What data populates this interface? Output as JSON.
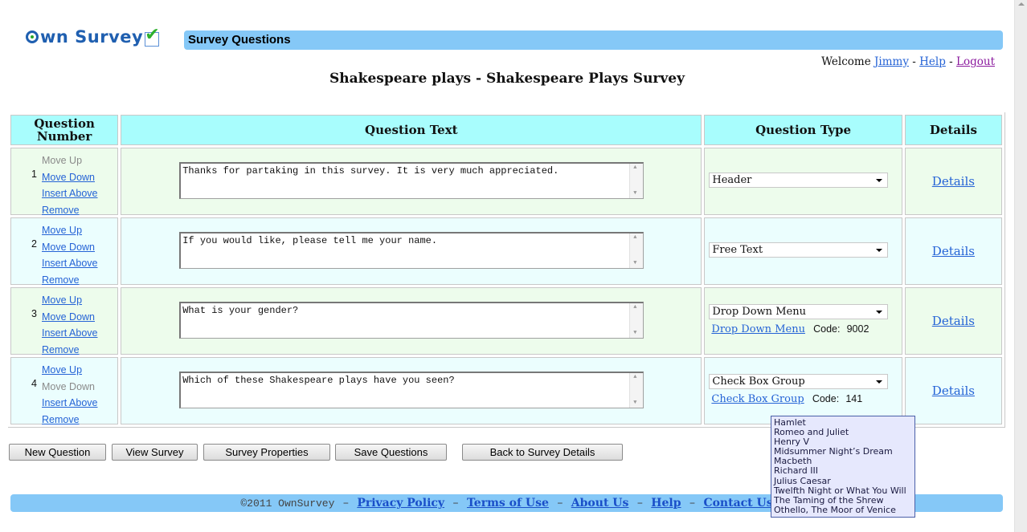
{
  "header": {
    "logo_text": "wn Survey",
    "page_heading": "Survey Questions",
    "welcome_prefix": "Welcome",
    "user_link": "Jimmy",
    "help_link": "Help",
    "logout_link": "Logout",
    "separator": "-",
    "survey_title": "Shakespeare plays - Shakespeare Plays Survey"
  },
  "table": {
    "columns": [
      "Question Number",
      "Question Text",
      "Question Type",
      "Details"
    ],
    "column_number_line1": "Question",
    "column_number_line2": "Number",
    "rows": [
      {
        "number": "1",
        "move_up": "Move Up",
        "move_up_enabled": false,
        "move_down": "Move Down",
        "move_down_enabled": true,
        "insert_above": "Insert Above",
        "remove": "Remove",
        "text": "Thanks for partaking in this survey. It is very much appreciated.",
        "type": "Header",
        "type_link": "",
        "code_label": "",
        "code": "",
        "details": "Details"
      },
      {
        "number": "2",
        "move_up": "Move Up",
        "move_up_enabled": true,
        "move_down": "Move Down",
        "move_down_enabled": true,
        "insert_above": "Insert Above",
        "remove": "Remove",
        "text": "If you would like, please tell me your name.",
        "type": "Free Text",
        "type_link": "",
        "code_label": "",
        "code": "",
        "details": "Details"
      },
      {
        "number": "3",
        "move_up": "Move Up",
        "move_up_enabled": true,
        "move_down": "Move Down",
        "move_down_enabled": true,
        "insert_above": "Insert Above",
        "remove": "Remove",
        "text": "What is your gender?",
        "type": "Drop Down Menu",
        "type_link": "Drop Down Menu",
        "code_label": "Code:",
        "code": "9002",
        "details": "Details"
      },
      {
        "number": "4",
        "move_up": "Move Up",
        "move_up_enabled": true,
        "move_down": "Move Down",
        "move_down_enabled": false,
        "insert_above": "Insert Above",
        "remove": "Remove",
        "text": "Which of these Shakespeare plays have you seen?",
        "type": "Check Box Group",
        "type_link": "Check Box Group",
        "code_label": "Code:",
        "code": "141",
        "details": "Details"
      }
    ]
  },
  "buttons": {
    "new_question": "New Question",
    "view_survey": "View Survey",
    "survey_properties": "Survey Properties",
    "save_questions": "Save Questions",
    "back_to_details": "Back to Survey Details"
  },
  "footer": {
    "copyright": "©2011 OwnSurvey",
    "separator": "–",
    "links": [
      "Privacy Policy",
      "Terms of Use",
      "About Us",
      "Help",
      "Contact Us"
    ]
  },
  "tooltip": {
    "items": [
      "Hamlet",
      "Romeo and Juliet",
      "Henry V",
      "Midsummer Night’s Dream",
      "Macbeth",
      "Richard III",
      "Julius Caesar",
      "Twelfth Night or What You Will",
      "The Taming of the Shrew",
      "Othello, The Moor of Venice"
    ]
  },
  "colors": {
    "title_bar": "#85c8f7",
    "table_header": "#a8fdfd",
    "row_odd": "#edfcec",
    "row_even": "#ebfefe",
    "link": "#2563d6",
    "visited_link": "#8b1a9e",
    "tooltip_bg": "#e6e8fd"
  }
}
